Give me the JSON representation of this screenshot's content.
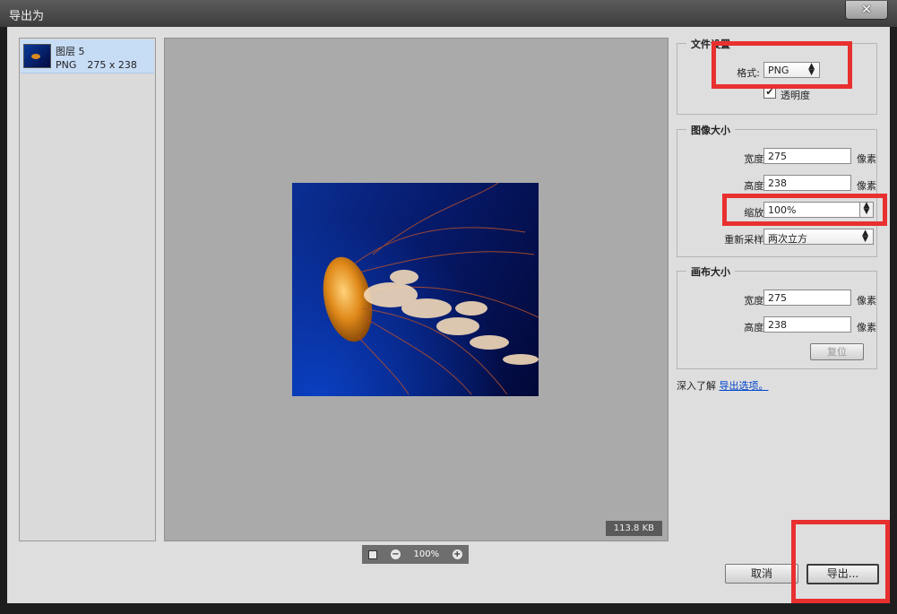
{
  "window": {
    "title": "导出为",
    "close_icon": "close-icon"
  },
  "layers_panel": {
    "items": [
      {
        "name": "图层 5",
        "format": "PNG",
        "dimensions": "275 x 238"
      }
    ]
  },
  "preview": {
    "file_size": "113.8 KB"
  },
  "zoom": {
    "level": "100%"
  },
  "file_settings": {
    "title": "文件设置",
    "format_label": "格式:",
    "format_value": "PNG",
    "transparency_label": "透明度",
    "transparency_checked": true
  },
  "image_size": {
    "title": "图像大小",
    "width_label": "宽度:",
    "width_value": "275",
    "height_label": "高度:",
    "height_value": "238",
    "scale_label": "缩放:",
    "scale_value": "100%",
    "resample_label": "重新采样:",
    "resample_value": "两次立方",
    "unit": "像素"
  },
  "canvas_size": {
    "title": "画布大小",
    "width_label": "宽度:",
    "width_value": "275",
    "height_label": "高度:",
    "height_value": "238",
    "unit": "像素",
    "reset_label": "复位"
  },
  "learn_more": {
    "prefix": "深入了解",
    "link": "导出选项。"
  },
  "buttons": {
    "cancel": "取消",
    "export": "导出..."
  },
  "colors": {
    "highlight": "#e8302f",
    "selection": "#c7dcf5",
    "link": "#0044cc"
  }
}
